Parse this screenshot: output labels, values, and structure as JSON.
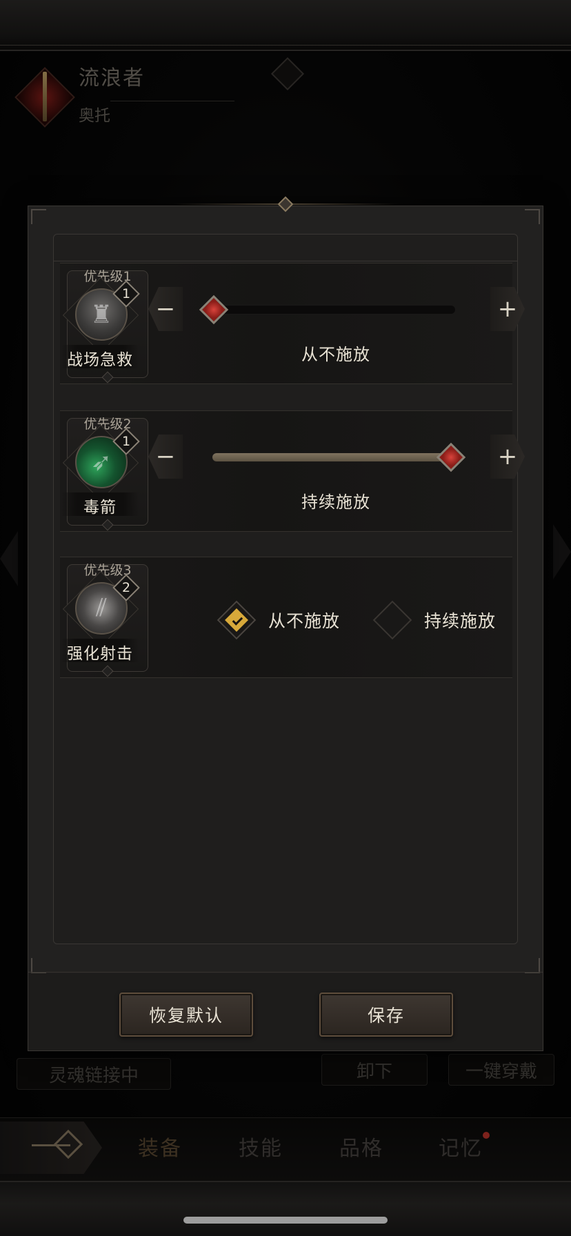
{
  "character": {
    "name": "流浪者",
    "subtitle": "奥托"
  },
  "background_buttons": {
    "soul_link": "灵魂链接中",
    "unequip": "卸下",
    "equip_all": "一键穿戴"
  },
  "bottom_nav": {
    "tabs": [
      {
        "label": "装备",
        "active": true
      },
      {
        "label": "技能",
        "active": false
      },
      {
        "label": "品格",
        "active": false
      },
      {
        "label": "记忆",
        "active": false,
        "notification_dot": true
      }
    ]
  },
  "modal": {
    "skills": [
      {
        "priority": "优先级1",
        "level": "1",
        "name": "战场急救",
        "control": "slider",
        "slider_value": 0,
        "value_label": "从不施放",
        "minus": "−",
        "plus": "+"
      },
      {
        "priority": "优先级2",
        "level": "1",
        "name": "毒箭",
        "control": "slider",
        "slider_value": 1,
        "value_label": "持续施放",
        "minus": "−",
        "plus": "+"
      },
      {
        "priority": "优先级3",
        "level": "2",
        "name": "强化射击",
        "control": "toggle",
        "options": [
          {
            "label": "从不施放",
            "checked": true
          },
          {
            "label": "持续施放",
            "checked": false
          }
        ]
      }
    ],
    "buttons": {
      "reset": "恢复默认",
      "save": "保存"
    }
  },
  "colors": {
    "accent_gold": "#d8a93a",
    "thumb_red": "#d8433c",
    "bg": "#222120"
  }
}
